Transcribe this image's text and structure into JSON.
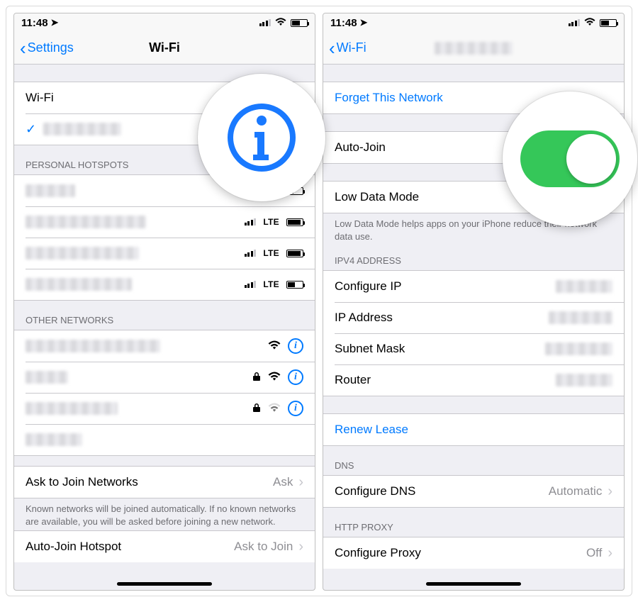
{
  "status": {
    "time": "11:48",
    "loc_arrow": "➤"
  },
  "left": {
    "back_label": "Settings",
    "title": "Wi-Fi",
    "wifi_row_label": "Wi-Fi",
    "sections": {
      "hotspots_header": "PERSONAL HOTSPOTS",
      "other_header": "OTHER NETWORKS",
      "lte_label": "LTE",
      "ask_label": "Ask to Join Networks",
      "ask_value": "Ask",
      "ask_footer": "Known networks will be joined automatically. If no known networks are available, you will be asked before joining a new network.",
      "autojoin_label": "Auto-Join Hotspot",
      "autojoin_value": "Ask to Join"
    }
  },
  "right": {
    "back_label": "Wi-Fi",
    "forget_label": "Forget This Network",
    "autojoin_label": "Auto-Join",
    "lowdata_label": "Low Data Mode",
    "lowdata_footer": "Low Data Mode helps apps on your iPhone reduce their network data use.",
    "ipv4_header": "IPV4 ADDRESS",
    "configure_ip_label": "Configure IP",
    "ip_address_label": "IP Address",
    "subnet_label": "Subnet Mask",
    "router_label": "Router",
    "renew_label": "Renew Lease",
    "dns_header": "DNS",
    "configure_dns_label": "Configure DNS",
    "configure_dns_value": "Automatic",
    "proxy_header": "HTTP PROXY",
    "configure_proxy_label": "Configure Proxy",
    "configure_proxy_value": "Off"
  }
}
